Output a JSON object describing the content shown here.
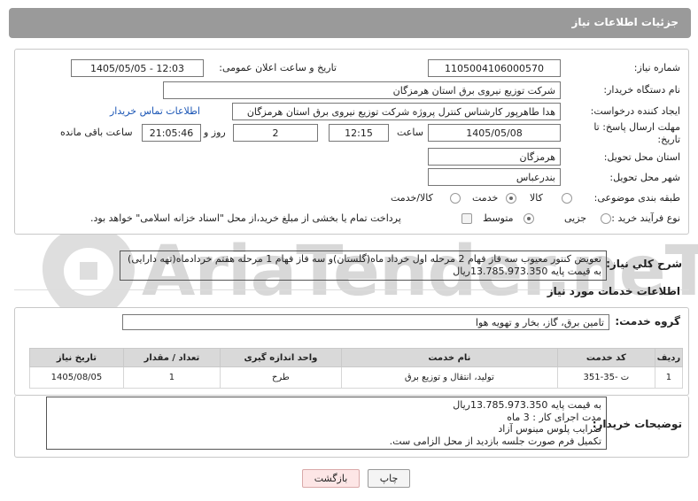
{
  "header": {
    "title": "جزئیات اطلاعات نیاز"
  },
  "fields": {
    "need_number_label": "شماره نیاز:",
    "need_number": "1105004106000570",
    "announce_label": "تاریخ و ساعت اعلان عمومی:",
    "announce_value": "1405/05/05 - 12:03",
    "buyer_label": "نام دستگاه خریدار:",
    "buyer_value": "شرکت توزیع نیروی برق استان هرمزگان",
    "creator_label": "ایجاد کننده درخواست:",
    "creator_value": "هدا طاهرپور کارشناس کنترل پروژه شرکت توزیع نیروی برق استان هرمزگان",
    "contact_link": "اطلاعات تماس خریدار",
    "deadline_label_1": "مهلت ارسال پاسخ: تا",
    "deadline_label_2": "تاریخ:",
    "deadline_date": "1405/05/08",
    "time_label": "ساعت",
    "deadline_time": "12:15",
    "days_value": "2",
    "days_label": "روز و",
    "remaining_time": "21:05:46",
    "remaining_label": "ساعت باقی مانده",
    "province_label": "استان محل تحویل:",
    "province_value": "هرمزگان",
    "city_label": "شهر محل تحویل:",
    "city_value": "بندرعباس",
    "category_label": "طبقه بندی موضوعی:",
    "category_options": [
      "کالا",
      "خدمت",
      "کالا/خدمت"
    ],
    "category_selected": "خدمت",
    "process_label": "نوع فرآیند خرید :",
    "process_options": [
      "جزیی",
      "متوسط"
    ],
    "process_selected": "متوسط",
    "payment_note": "پرداخت تمام یا بخشی از مبلغ خرید،از محل \"اسناد خزانه اسلامی\" خواهد بود."
  },
  "summary": {
    "label": "شرح کلي نياز:",
    "text": "تعویض کنتور معیوب سه فاز فهام 2 مرحله اول خرداد ماه(گلستان)و سه فاز فهام 1 مرحله هفتم خردادماه(تهه دارایی) به قیمت پایه 13.785.973.350ریال"
  },
  "services": {
    "section_title": "اطلاعات خدمات مورد نياز",
    "group_label": "گروه خدمت:",
    "group_value": "تامین برق، گاز، بخار و تهویه هوا",
    "columns": [
      "ردیف",
      "کد خدمت",
      "نام خدمت",
      "واحد اندازه گیری",
      "تعداد / مقدار",
      "تاریخ نیاز"
    ],
    "rows": [
      {
        "index": "1",
        "code": "ت -35-351",
        "name": "تولید، انتقال و توزیع برق",
        "unit": "طرح",
        "qty": "1",
        "date": "1405/08/05"
      }
    ]
  },
  "buyer_notes": {
    "label": "توضیحات خریدار:",
    "lines": [
      "به قیمت  پایه   13.785.973.350ریال",
      "مدت اجرای کار : 3 ماه",
      "ضرایب پلوس مینوس آزاد",
      "تکمیل فرم صورت جلسه بازدید از محل الزامی ست."
    ]
  },
  "buttons": {
    "print": "چاپ",
    "back": "بازگشت"
  },
  "watermark": "AriaTender.neT",
  "colors": {
    "header": "#9a9a9a",
    "link": "#1a55b5",
    "back_button": "#fde6e6"
  }
}
